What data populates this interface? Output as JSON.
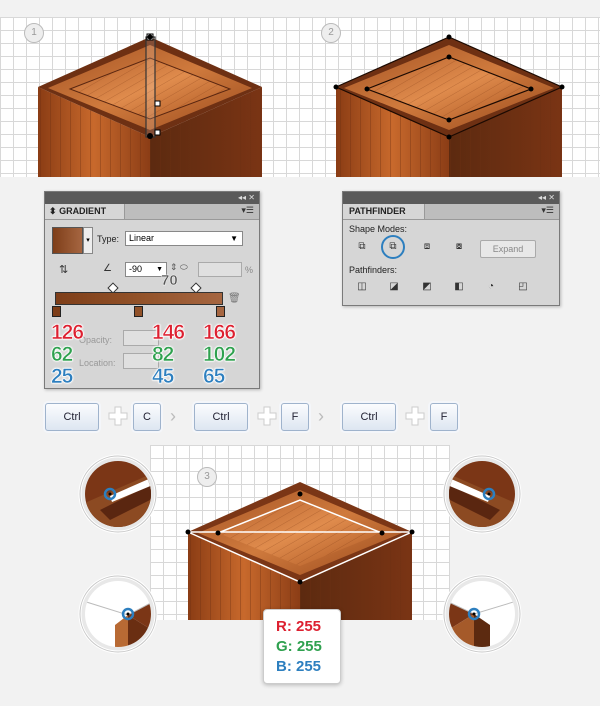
{
  "steps": {
    "one": "1",
    "two": "2",
    "three": "3"
  },
  "gradient_panel": {
    "tab": "GRADIENT",
    "type_label": "Type:",
    "type_value": "Linear",
    "angle_value": "-90",
    "pct": "%",
    "midpoint": "70",
    "opacity_label": "Opacity:",
    "location_label": "Location:",
    "stop_colors": {
      "left": {
        "r": "126",
        "g": "62",
        "b": "25"
      },
      "mid": {
        "r": "146",
        "g": "82",
        "b": "45"
      },
      "right": {
        "r": "166",
        "g": "102",
        "b": "65"
      }
    }
  },
  "pathfinder_panel": {
    "tab": "PATHFINDER",
    "shape_modes_label": "Shape Modes:",
    "pathfinders_label": "Pathfinders:",
    "expand_label": "Expand"
  },
  "shortcuts": {
    "ctrl": "Ctrl",
    "c": "C",
    "f": "F"
  },
  "rgb_box": {
    "r": "R: 255",
    "g": "G: 255",
    "b": "B: 255"
  },
  "colors": {
    "wood_dark": "#7e3e19",
    "wood_mid": "#925229",
    "wood_light": "#a66641",
    "accent_red": "#dd2030",
    "accent_green": "#2fa14f",
    "accent_blue": "#2d7fbf"
  }
}
